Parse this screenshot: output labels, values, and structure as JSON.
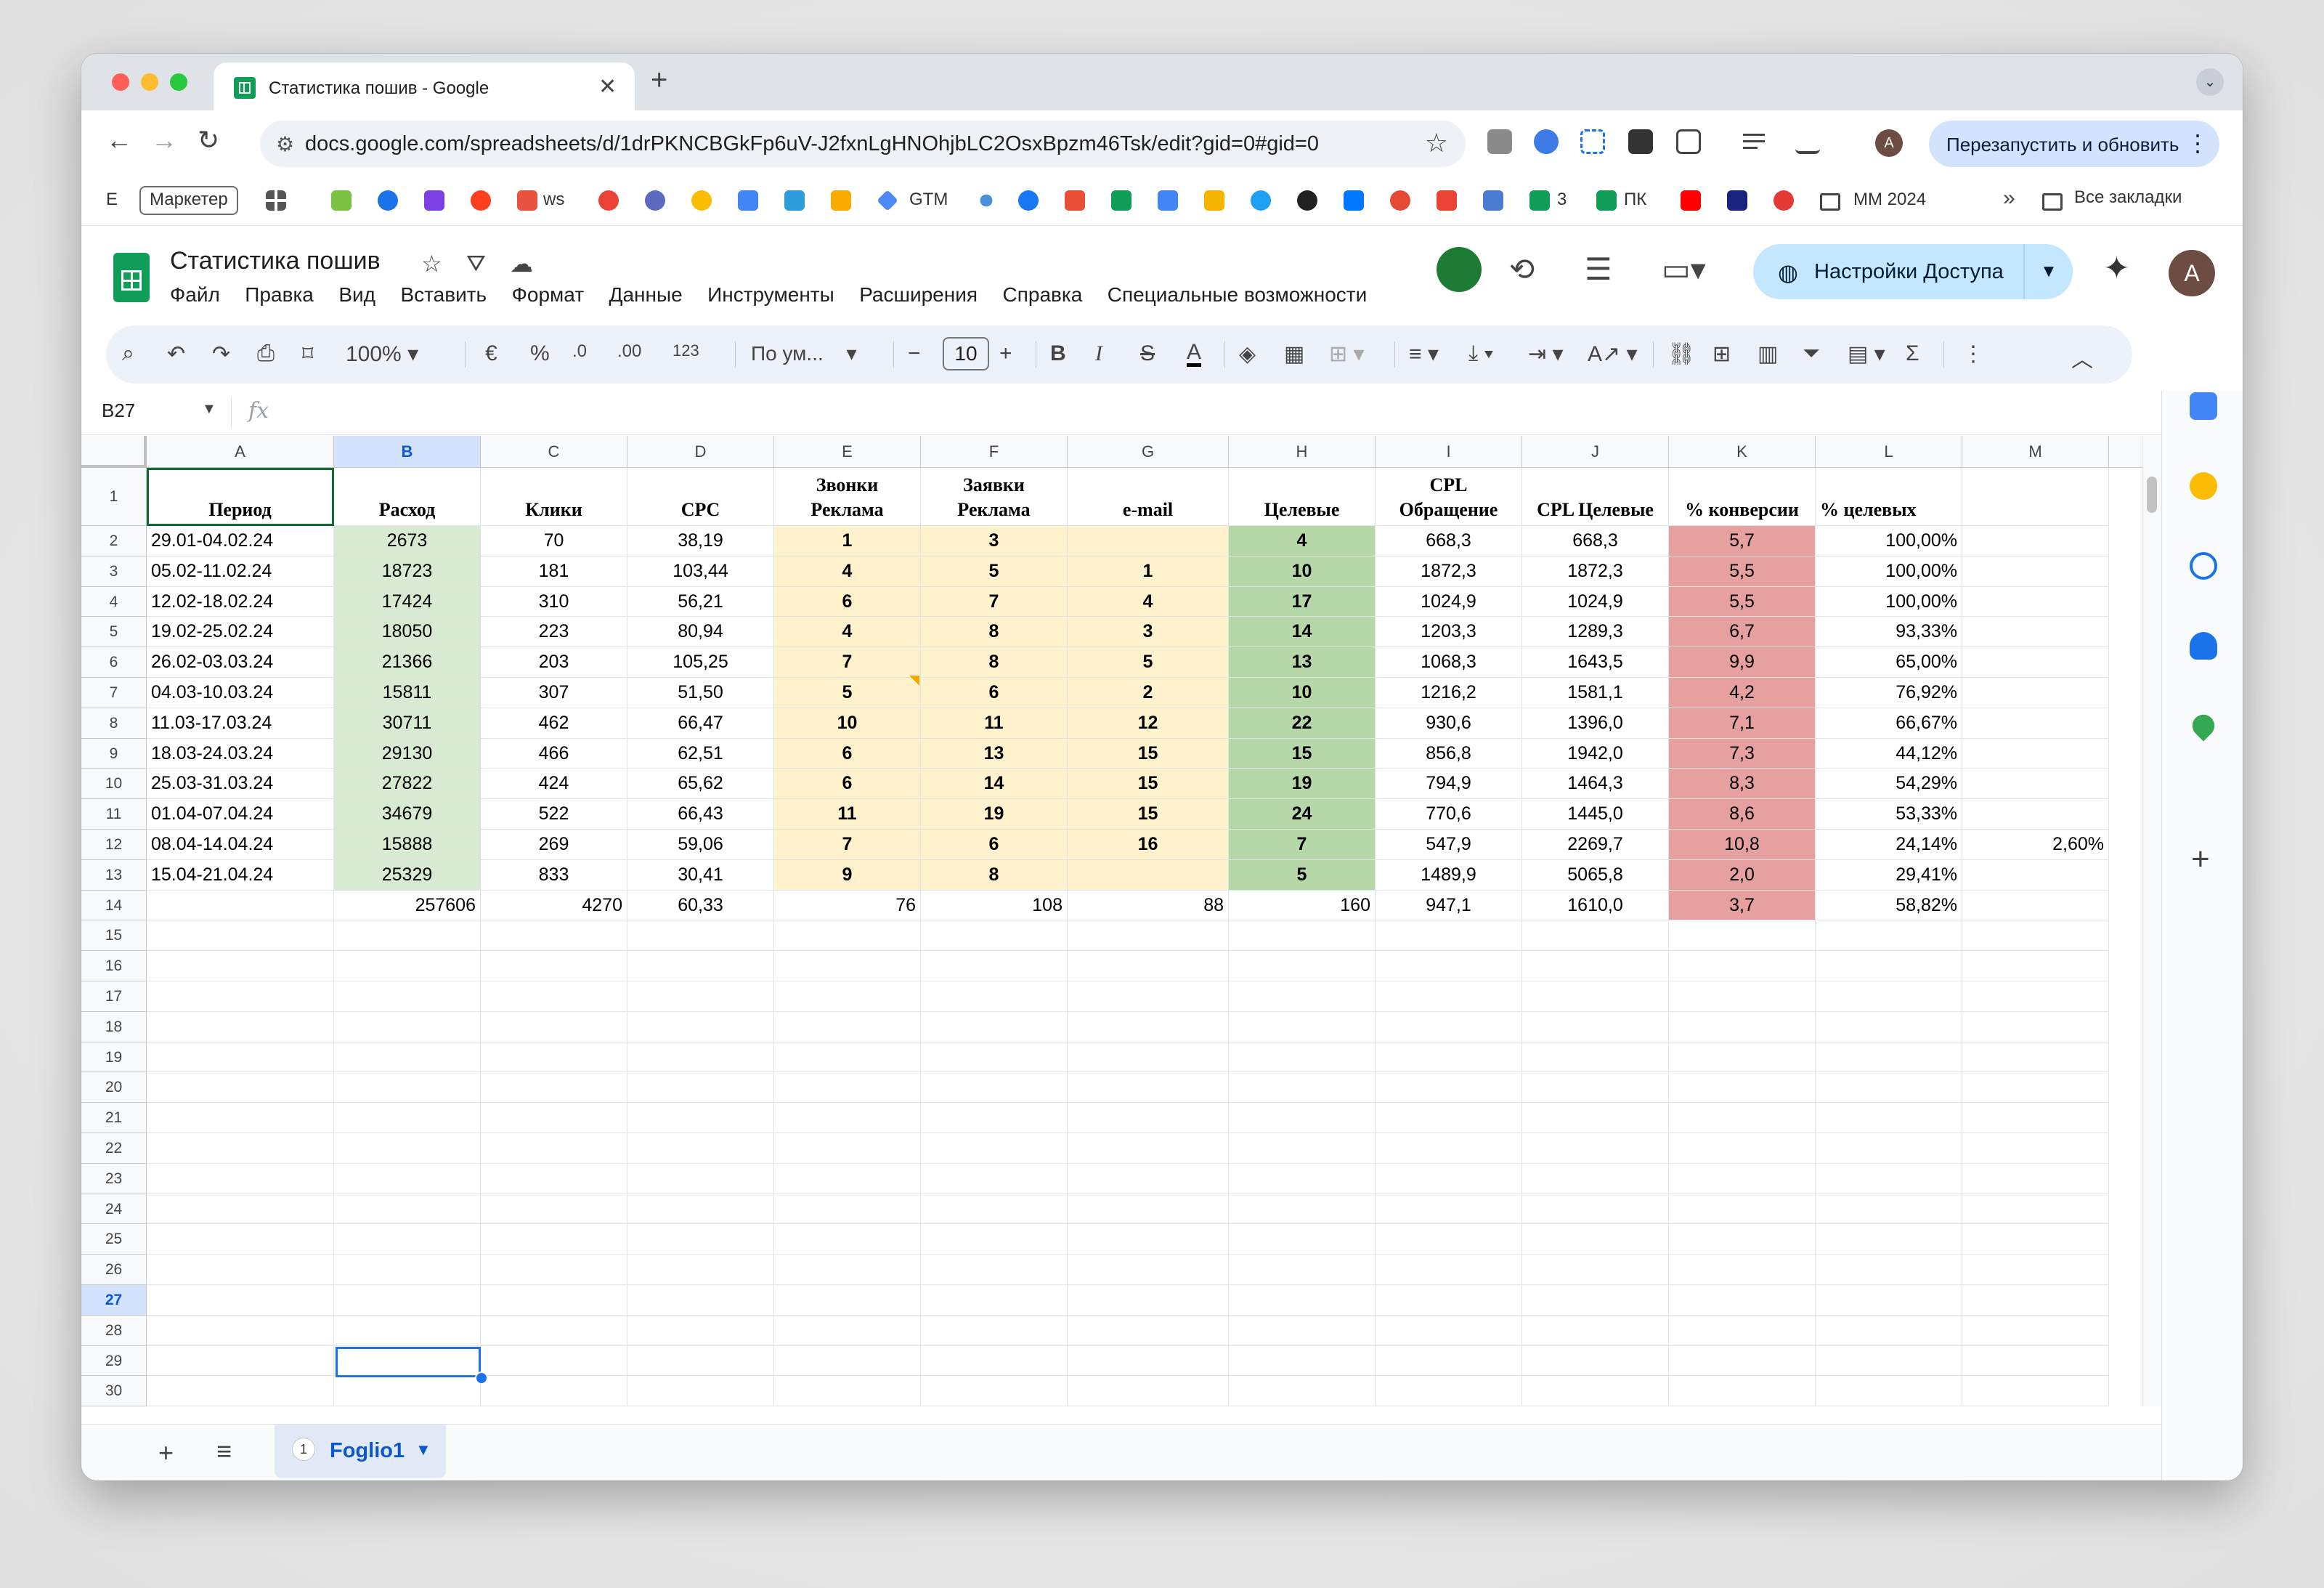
{
  "browser": {
    "tab_title": "Статистика пошив - Google",
    "tab_close": "✕",
    "new_tab": "+",
    "url": "docs.google.com/spreadsheets/d/1drPKNCBGkFp6uV-J2fxnLgHNOhjbLC2OsxBpzm46Tsk/edit?gid=0#gid=0",
    "relaunch_label": "Перезапустить и обновить",
    "profile_initial": "A",
    "bookmarks": {
      "first": "E",
      "chip": "Маркетер",
      "ws": "ws",
      "gtm": "GTM",
      "num3": "3",
      "pk": "ПК",
      "mm": "MM 2024",
      "all": "Все закладки"
    }
  },
  "sheets": {
    "title": "Статистика пошив",
    "menu": [
      "Файл",
      "Правка",
      "Вид",
      "Вставить",
      "Формат",
      "Данные",
      "Инструменты",
      "Расширения",
      "Справка",
      "Специальные возможности"
    ],
    "share_label": "Настройки Доступа",
    "account_initial": "A",
    "toolbar": {
      "zoom": "100%",
      "currency": "€",
      "percent": "%",
      "dec_less": ".0",
      "dec_more": ".00",
      "number_format": "123",
      "font": "По ум...",
      "font_size": "10",
      "bold": "B",
      "italic": "I",
      "strike": "S",
      "text_color": "A"
    },
    "name_box": "B27",
    "fx_label": "fx",
    "sheet_tab": {
      "number": "1",
      "name": "Foglio1"
    }
  },
  "grid": {
    "columns": [
      "A",
      "B",
      "C",
      "D",
      "E",
      "F",
      "G",
      "H",
      "I",
      "J",
      "K",
      "L",
      "M"
    ],
    "rows": [
      "1",
      "2",
      "3",
      "4",
      "5",
      "6",
      "7",
      "8",
      "9",
      "10",
      "11",
      "12",
      "13",
      "14",
      "15",
      "16",
      "17",
      "18",
      "19",
      "20",
      "21",
      "22",
      "23",
      "24",
      "25",
      "26",
      "27",
      "28",
      "29",
      "30"
    ],
    "header_row": {
      "A": "Период",
      "B": "Расход",
      "C": "Клики",
      "D": "CPC",
      "E": [
        "Звонки",
        "Реклама"
      ],
      "F": [
        "Заявки",
        "Реклама"
      ],
      "G": "e-mail",
      "H": "Целевые",
      "I": [
        "CPL",
        "Обращение"
      ],
      "J": "CPL Целевые",
      "K": "% конверсии",
      "L": "% целевых"
    },
    "data_rows": [
      [
        "29.01-04.02.24",
        "2673",
        "70",
        "38,19",
        "1",
        "3",
        "",
        "4",
        "668,3",
        "668,3",
        "5,7",
        "100,00%",
        ""
      ],
      [
        "05.02-11.02.24",
        "18723",
        "181",
        "103,44",
        "4",
        "5",
        "1",
        "10",
        "1872,3",
        "1872,3",
        "5,5",
        "100,00%",
        ""
      ],
      [
        "12.02-18.02.24",
        "17424",
        "310",
        "56,21",
        "6",
        "7",
        "4",
        "17",
        "1024,9",
        "1024,9",
        "5,5",
        "100,00%",
        ""
      ],
      [
        "19.02-25.02.24",
        "18050",
        "223",
        "80,94",
        "4",
        "8",
        "3",
        "14",
        "1203,3",
        "1289,3",
        "6,7",
        "93,33%",
        ""
      ],
      [
        "26.02-03.03.24",
        "21366",
        "203",
        "105,25",
        "7",
        "8",
        "5",
        "13",
        "1068,3",
        "1643,5",
        "9,9",
        "65,00%",
        ""
      ],
      [
        "04.03-10.03.24",
        "15811",
        "307",
        "51,50",
        "5",
        "6",
        "2",
        "10",
        "1216,2",
        "1581,1",
        "4,2",
        "76,92%",
        ""
      ],
      [
        "11.03-17.03.24",
        "30711",
        "462",
        "66,47",
        "10",
        "11",
        "12",
        "22",
        "930,6",
        "1396,0",
        "7,1",
        "66,67%",
        ""
      ],
      [
        "18.03-24.03.24",
        "29130",
        "466",
        "62,51",
        "6",
        "13",
        "15",
        "15",
        "856,8",
        "1942,0",
        "7,3",
        "44,12%",
        ""
      ],
      [
        "25.03-31.03.24",
        "27822",
        "424",
        "65,62",
        "6",
        "14",
        "15",
        "19",
        "794,9",
        "1464,3",
        "8,3",
        "54,29%",
        ""
      ],
      [
        "01.04-07.04.24",
        "34679",
        "522",
        "66,43",
        "11",
        "19",
        "15",
        "24",
        "770,6",
        "1445,0",
        "8,6",
        "53,33%",
        ""
      ],
      [
        "08.04-14.04.24",
        "15888",
        "269",
        "59,06",
        "7",
        "6",
        "16",
        "7",
        "547,9",
        "2269,7",
        "10,8",
        "24,14%",
        "2,60%"
      ],
      [
        "15.04-21.04.24",
        "25329",
        "833",
        "30,41",
        "9",
        "8",
        "",
        "5",
        "1489,9",
        "5065,8",
        "2,0",
        "29,41%",
        ""
      ]
    ],
    "total_row": [
      "",
      "257606",
      "4270",
      "60,33",
      "76",
      "108",
      "88",
      "160",
      "947,1",
      "1610,0",
      "3,7",
      "58,82%",
      ""
    ],
    "colors": {
      "spend_fill": "#d9ead3",
      "leads_fill": "#fff2cc",
      "target_fill": "#b6d7a8",
      "conversion_fill": "#e6a0a0",
      "selection": "#1a73e8",
      "header_select": "#d3e3fd"
    }
  }
}
